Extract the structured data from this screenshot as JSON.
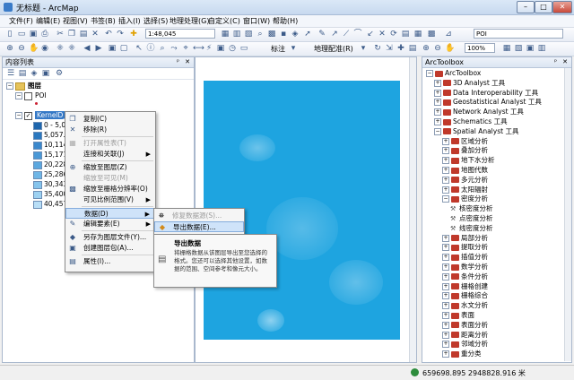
{
  "window": {
    "title": "无标题 - ArcMap",
    "controls": [
      "–",
      "□",
      "✕"
    ]
  },
  "menu": [
    "文件(F)",
    "编辑(E)",
    "视图(V)",
    "书签(B)",
    "插入(I)",
    "选择(S)",
    "地理处理(G)",
    "自定义(C)",
    "窗口(W)",
    "帮助(H)"
  ],
  "toolbar": {
    "scale": "1:48,045",
    "label_text": "标注",
    "georef_label": "地理配准(R)",
    "layer_select": "POI",
    "zoom_pct": "100%"
  },
  "toc": {
    "title": "内容列表",
    "root": "图层",
    "layers": [
      {
        "name": "POI"
      },
      {
        "name": "KernelD_shp1"
      }
    ],
    "legend": [
      "0 - 5,05",
      "5,057.26",
      "10,114.",
      "15,171.",
      "20,228.",
      "25,286.",
      "30,343.",
      "35,400.",
      "40,457."
    ],
    "legend_colors": [
      "#1e66ad",
      "#2a78bf",
      "#3b88cc",
      "#4a98d6",
      "#5ca8df",
      "#6fb6e6",
      "#85c4ec",
      "#9dd1f1",
      "#b8def6"
    ]
  },
  "context_menu": [
    {
      "icon": "copy-icon",
      "label": "复制(C)",
      "disabled": false
    },
    {
      "icon": "remove-icon",
      "label": "移除(R)",
      "disabled": false
    },
    {
      "icon": "table-icon",
      "label": "打开属性表(T)",
      "disabled": true
    },
    {
      "icon": "",
      "label": "连接和关联(J)",
      "disabled": false,
      "submenu": true
    },
    {
      "icon": "zoom-icon",
      "label": "缩放至图层(Z)",
      "disabled": false
    },
    {
      "icon": "",
      "label": "缩放至可见(M)",
      "disabled": true
    },
    {
      "icon": "raster-icon",
      "label": "缩放至栅格分辨率(O)",
      "disabled": false
    },
    {
      "icon": "",
      "label": "可见比例范围(V)",
      "disabled": false,
      "submenu": true
    },
    {
      "icon": "",
      "label": "数据(D)",
      "disabled": false,
      "submenu": true,
      "highlight": true
    },
    {
      "icon": "edit-icon",
      "label": "编辑要素(E)",
      "disabled": false,
      "submenu": true
    },
    {
      "icon": "save-icon",
      "label": "另存为图层文件(Y)...",
      "disabled": false
    },
    {
      "icon": "package-icon",
      "label": "创建图层包(A)...",
      "disabled": false
    },
    {
      "icon": "properties-icon",
      "label": "属性(I)...",
      "disabled": false
    }
  ],
  "submenu": [
    {
      "label": "修复数据源(S)...",
      "disabled": true
    },
    {
      "label": "导出数据(E)...",
      "disabled": false,
      "highlight": true
    }
  ],
  "tooltip": {
    "title": "导出数据",
    "body": "将栅格数据从该图层导出至您选择的格式。您还可以选择其他设置，如数据的范围、空间参考和像元大小。"
  },
  "toolbox": {
    "title": "ArcToolbox",
    "items": [
      {
        "level": 0,
        "type": "root",
        "label": "ArcToolbox"
      },
      {
        "level": 1,
        "type": "box",
        "label": "3D Analyst 工具"
      },
      {
        "level": 1,
        "type": "box",
        "label": "Data Interoperability 工具"
      },
      {
        "level": 1,
        "type": "box",
        "label": "Geostatistical Analyst 工具"
      },
      {
        "level": 1,
        "type": "box",
        "label": "Network Analyst 工具"
      },
      {
        "level": 1,
        "type": "box",
        "label": "Schematics 工具"
      },
      {
        "level": 1,
        "type": "box",
        "label": "Spatial Analyst 工具",
        "open": true
      },
      {
        "level": 2,
        "type": "box",
        "label": "区域分析"
      },
      {
        "level": 2,
        "type": "box",
        "label": "叠加分析"
      },
      {
        "level": 2,
        "type": "box",
        "label": "地下水分析"
      },
      {
        "level": 2,
        "type": "box",
        "label": "地图代数"
      },
      {
        "level": 2,
        "type": "box",
        "label": "多元分析"
      },
      {
        "level": 2,
        "type": "box",
        "label": "太阳辐射"
      },
      {
        "level": 2,
        "type": "box",
        "label": "密度分析",
        "open": true
      },
      {
        "level": 3,
        "type": "tool",
        "label": "核密度分析"
      },
      {
        "level": 3,
        "type": "tool",
        "label": "点密度分析"
      },
      {
        "level": 3,
        "type": "tool",
        "label": "线密度分析"
      },
      {
        "level": 2,
        "type": "box",
        "label": "局部分析"
      },
      {
        "level": 2,
        "type": "box",
        "label": "提取分析"
      },
      {
        "level": 2,
        "type": "box",
        "label": "插值分析"
      },
      {
        "level": 2,
        "type": "box",
        "label": "数学分析"
      },
      {
        "level": 2,
        "type": "box",
        "label": "条件分析"
      },
      {
        "level": 2,
        "type": "box",
        "label": "栅格创建"
      },
      {
        "level": 2,
        "type": "box",
        "label": "栅格综合"
      },
      {
        "level": 2,
        "type": "box",
        "label": "水文分析"
      },
      {
        "level": 2,
        "type": "box",
        "label": "表面"
      },
      {
        "level": 2,
        "type": "box",
        "label": "表面分析"
      },
      {
        "level": 2,
        "type": "box",
        "label": "距离分析"
      },
      {
        "level": 2,
        "type": "box",
        "label": "邻域分析"
      },
      {
        "level": 2,
        "type": "box",
        "label": "重分类"
      }
    ]
  },
  "status": {
    "coords": "659698.895  2948828.916 米"
  }
}
